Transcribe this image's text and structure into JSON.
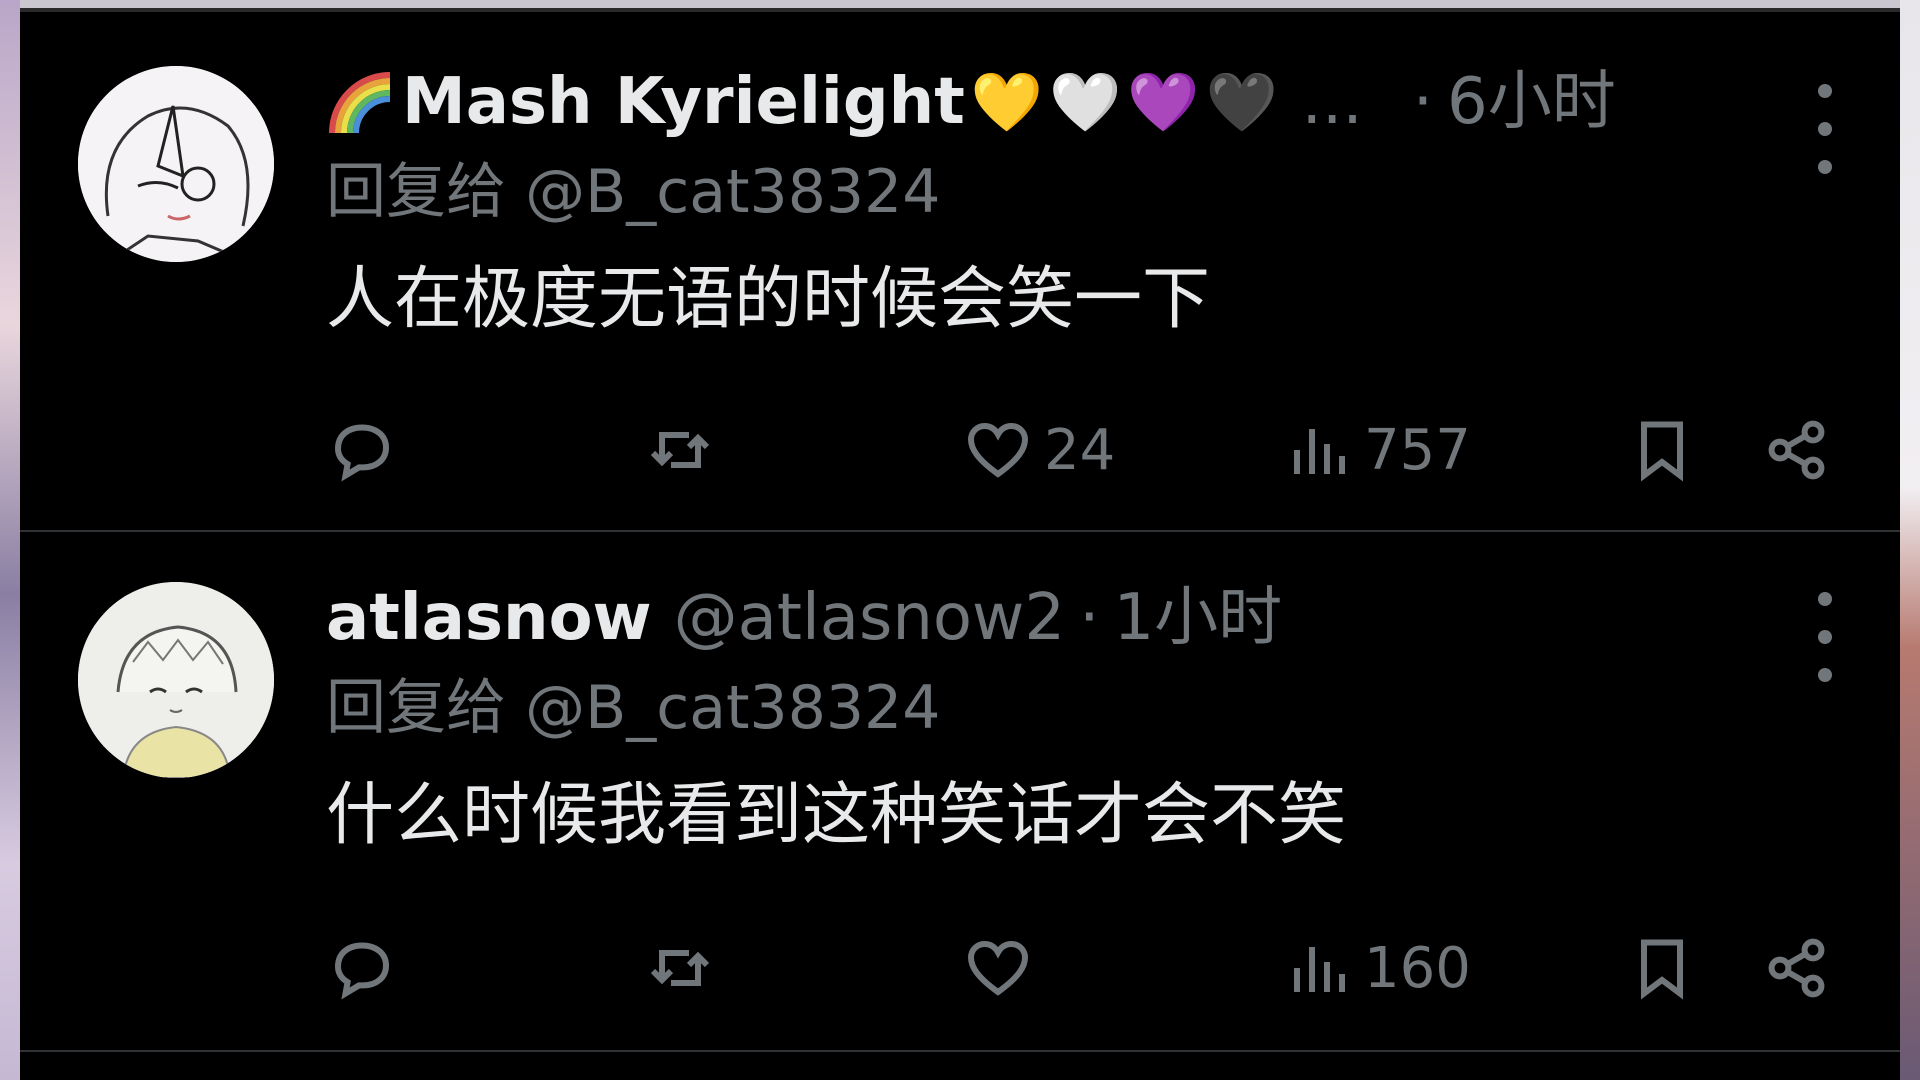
{
  "posts": [
    {
      "display_name": "Mash Kyrielight",
      "emoji": [
        "💛",
        "🤍",
        "💜",
        "🖤"
      ],
      "truncation": "...",
      "handle": "",
      "separator": "·",
      "time": "6小时",
      "reply_to": "回复给 @B_cat38324",
      "text": "人在极度无语的时候会笑一下",
      "stats": {
        "likes": "24",
        "views": "757",
        "retweets": "",
        "replies": ""
      }
    },
    {
      "display_name": "atlasnow",
      "emoji": [],
      "truncation": "",
      "handle": "@atlasnow2",
      "separator": "·",
      "time": "1小时",
      "reply_to": "回复给 @B_cat38324",
      "text": "什么时候我看到这种笑话才会不笑",
      "stats": {
        "likes": "",
        "views": "160",
        "retweets": "",
        "replies": ""
      }
    }
  ],
  "icons": [
    "reply-icon",
    "retweet-icon",
    "like-icon",
    "views-icon",
    "bookmark-icon",
    "share-icon",
    "more-icon"
  ],
  "colors": {
    "background": "#000000",
    "text_primary": "#e7e9ea",
    "text_secondary": "#71767b",
    "divider": "#2f3336"
  }
}
